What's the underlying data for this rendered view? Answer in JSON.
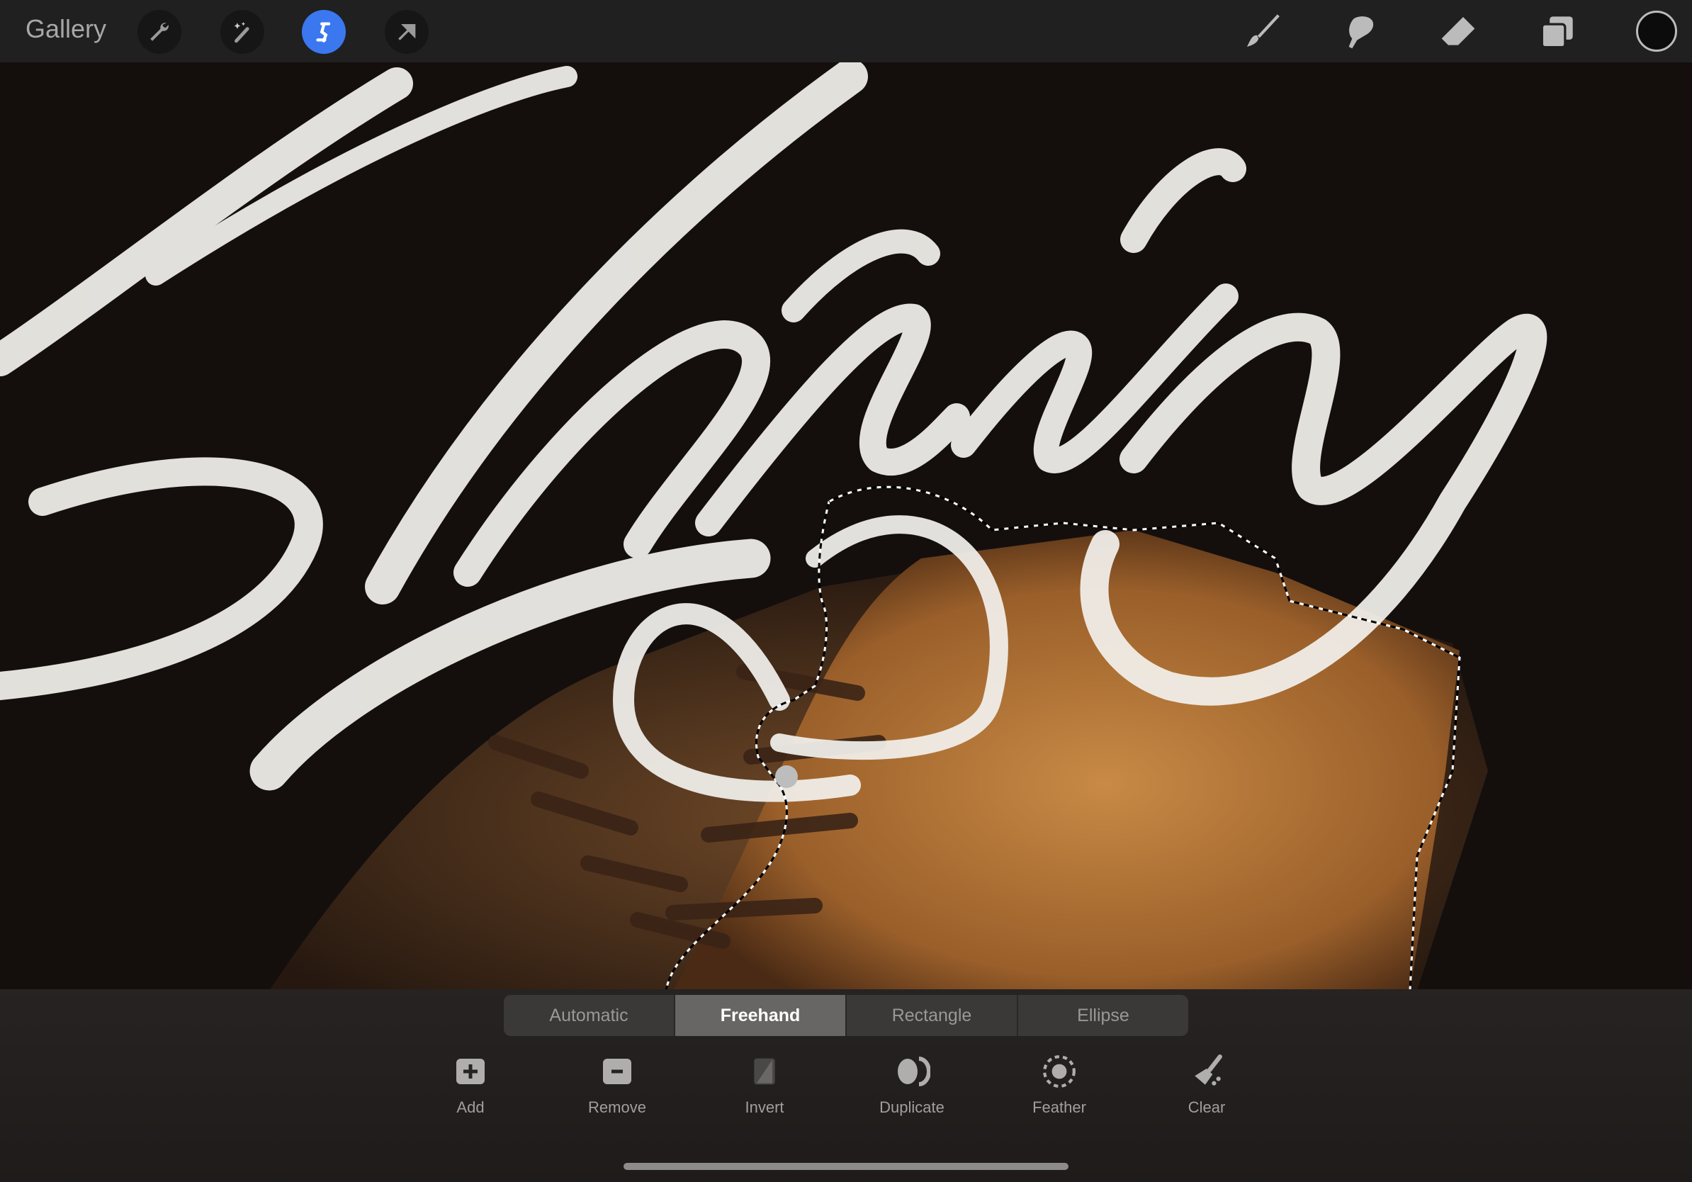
{
  "topbar": {
    "gallery": "Gallery",
    "left_tools": [
      {
        "icon": "wrench-icon",
        "name": "actions"
      },
      {
        "icon": "magic-wand-icon",
        "name": "adjustments"
      },
      {
        "icon": "selection-icon",
        "name": "selection",
        "active": true
      },
      {
        "icon": "arrow-icon",
        "name": "transform"
      }
    ],
    "right_tools": [
      {
        "icon": "brush-icon"
      },
      {
        "icon": "smudge-icon"
      },
      {
        "icon": "eraser-icon"
      },
      {
        "icon": "layers-icon"
      }
    ],
    "color": "#0c0c0c",
    "accent": "#3b78f0"
  },
  "selection": {
    "modes": [
      "Automatic",
      "Freehand",
      "Rectangle",
      "Ellipse"
    ],
    "selected": "Freehand",
    "tools": [
      {
        "label": "Add",
        "icon": "add-icon"
      },
      {
        "label": "Remove",
        "icon": "remove-icon"
      },
      {
        "label": "Invert",
        "icon": "invert-icon"
      },
      {
        "label": "Duplicate",
        "icon": "duplicate-icon"
      },
      {
        "label": "Feather",
        "icon": "feather-icon"
      },
      {
        "label": "Clear",
        "icon": "clear-icon"
      }
    ]
  }
}
